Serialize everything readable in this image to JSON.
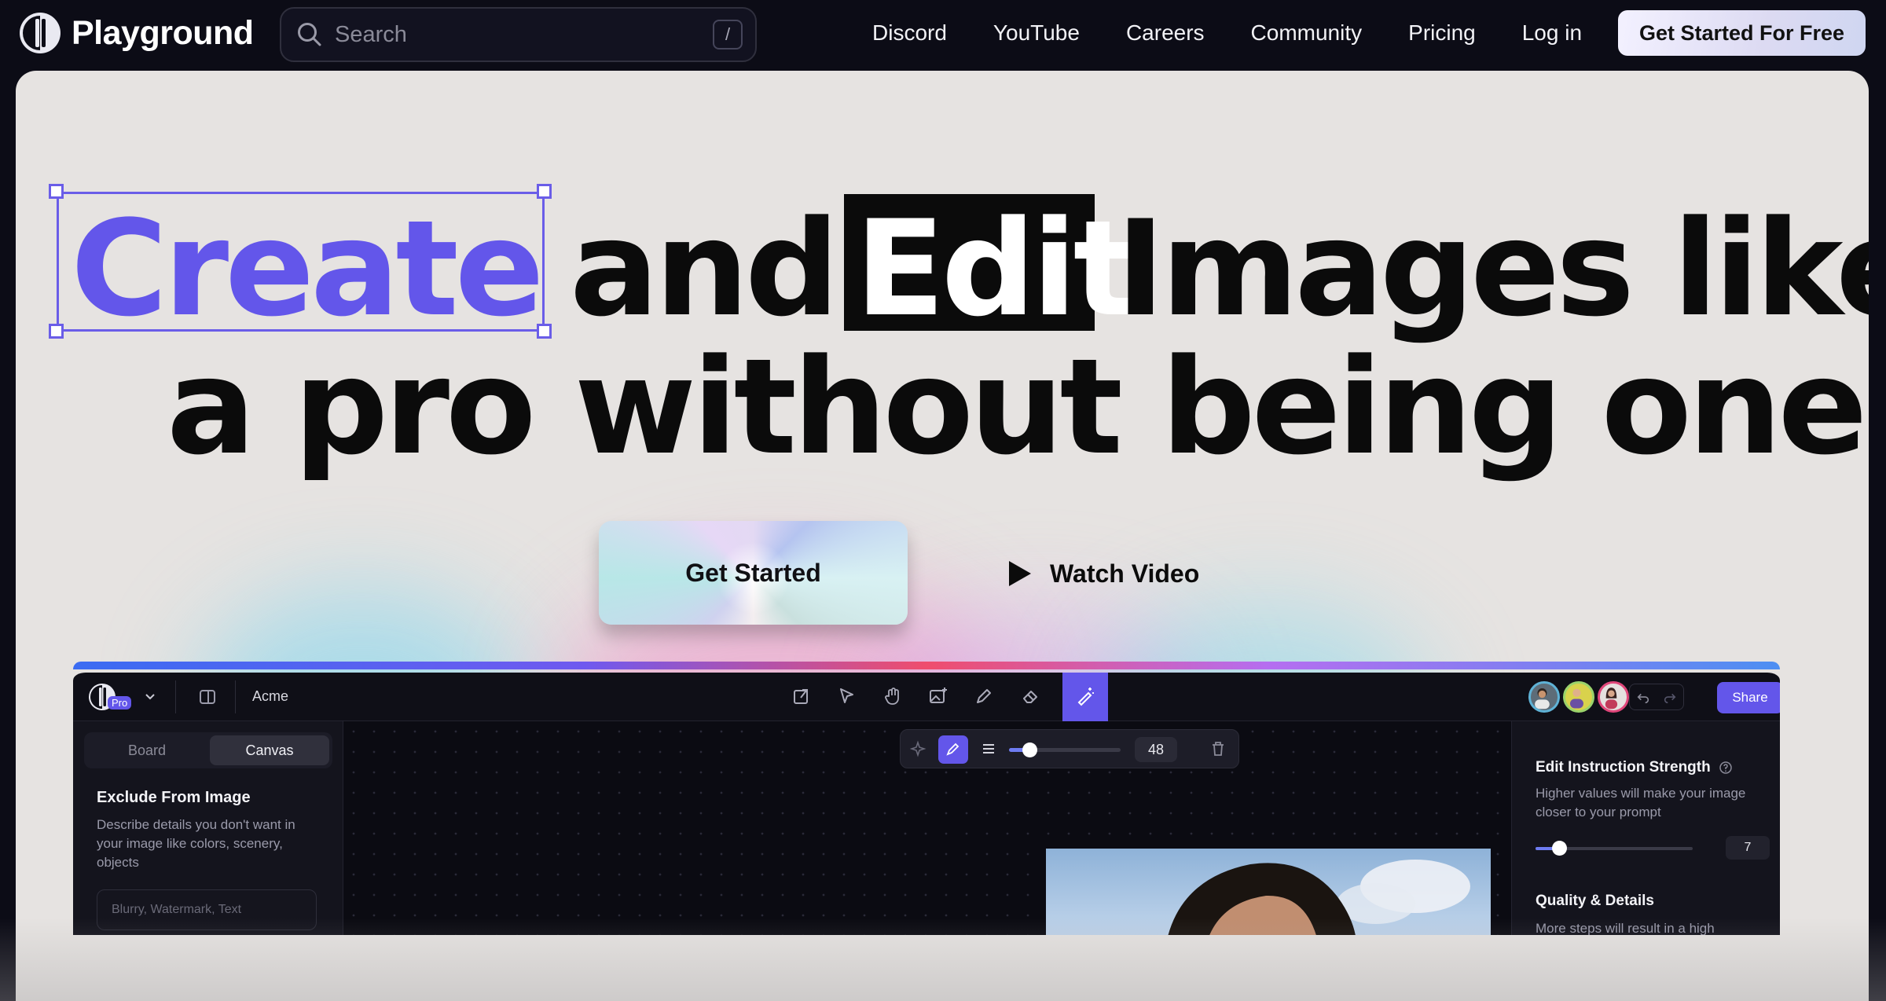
{
  "brand": {
    "name": "Playground"
  },
  "search": {
    "placeholder": "Search",
    "shortcut": "/"
  },
  "nav": {
    "links": [
      "Discord",
      "YouTube",
      "Careers",
      "Community",
      "Pricing",
      "Log in"
    ],
    "cta": "Get Started For Free"
  },
  "hero": {
    "word_create": "Create",
    "word_and": "and",
    "word_edit": "Edit",
    "line1_rest": "Images like",
    "line2": "a pro without being one.",
    "accent_color": "#6356ea"
  },
  "actions": {
    "primary": "Get Started",
    "secondary": "Watch Video"
  },
  "app": {
    "plan_badge": "Pro",
    "workspace": "Acme",
    "share": "Share",
    "tabs": [
      "Board",
      "Canvas"
    ],
    "active_tab": "Canvas",
    "tools": [
      "upload-icon",
      "select-arrow-icon",
      "hand-icon",
      "image-plus-icon",
      "pen-icon",
      "eraser-icon",
      "magic-wand-icon"
    ],
    "brush": {
      "size": "48",
      "slider_fraction": 0.18
    },
    "exclude": {
      "title": "Exclude From Image",
      "description": "Describe details you don't want in your image like colors, scenery, objects",
      "placeholder": "Blurry, Watermark, Text"
    },
    "strength": {
      "title": "Edit Instruction Strength",
      "description": "Higher values will make your image closer to your prompt",
      "value": "7",
      "slider_fraction": 0.15
    },
    "quality": {
      "title": "Quality & Details",
      "description": "More steps will result in a high"
    }
  }
}
